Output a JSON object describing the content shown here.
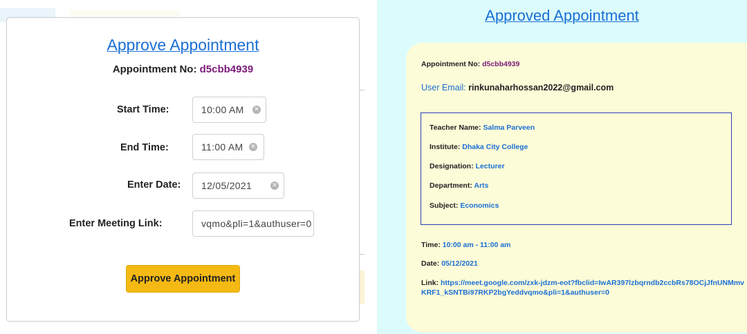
{
  "approve_form": {
    "title": "Approve Appointment",
    "appointment_label": "Appointment No: ",
    "appointment_no": "d5cbb4939",
    "start_time": {
      "label": "Start Time:",
      "value": "10:00  AM"
    },
    "end_time": {
      "label": "End Time:",
      "value": "11:00  AM"
    },
    "date": {
      "label": "Enter Date:",
      "value": "12/05/2021"
    },
    "meeting_link": {
      "label": "Enter Meeting Link:",
      "value": "vqmo&pli=1&authuser=0"
    },
    "approve_button": "Approve Appointment"
  },
  "approved_view": {
    "title": "Approved Appointment",
    "appointment_label": "Appointment No: ",
    "appointment_no": "d5cbb4939",
    "user_email_label": "User Email: ",
    "user_email": "rinkunaharhossan2022@gmail.com",
    "teacher": {
      "name_label": "Teacher Name: ",
      "name": "Salma Parveen",
      "institute_label": "Institute: ",
      "institute": "Dhaka City College",
      "designation_label": "Designation: ",
      "designation": "Lecturer",
      "department_label": "Department: ",
      "department": "Arts",
      "subject_label": "Subject: ",
      "subject": "Economics"
    },
    "time_label": "Time: ",
    "time": "10:00 am - 11:00 am",
    "date_label": "Date: ",
    "date": "05/12/2021",
    "link_label": "Link: ",
    "link": "https://meet.google.com/zxk-jdzm-eot?fbclid=IwAR397lzbqrndb2ccbRs78OCjJfnUNMmvKRF1_kSNTBi97RKP2bgYeddvqmo&pli=1&authuser=0"
  },
  "colors": {
    "accent_blue": "#1a6fd4",
    "appointment_purple": "#7a1a7a",
    "button_yellow": "#f5b914",
    "right_background": "#dcfcfc",
    "detail_card": "#fdfcd8",
    "teacher_border": "#2b3db8"
  },
  "icons": {
    "clear_input": "clear-circle-icon"
  }
}
